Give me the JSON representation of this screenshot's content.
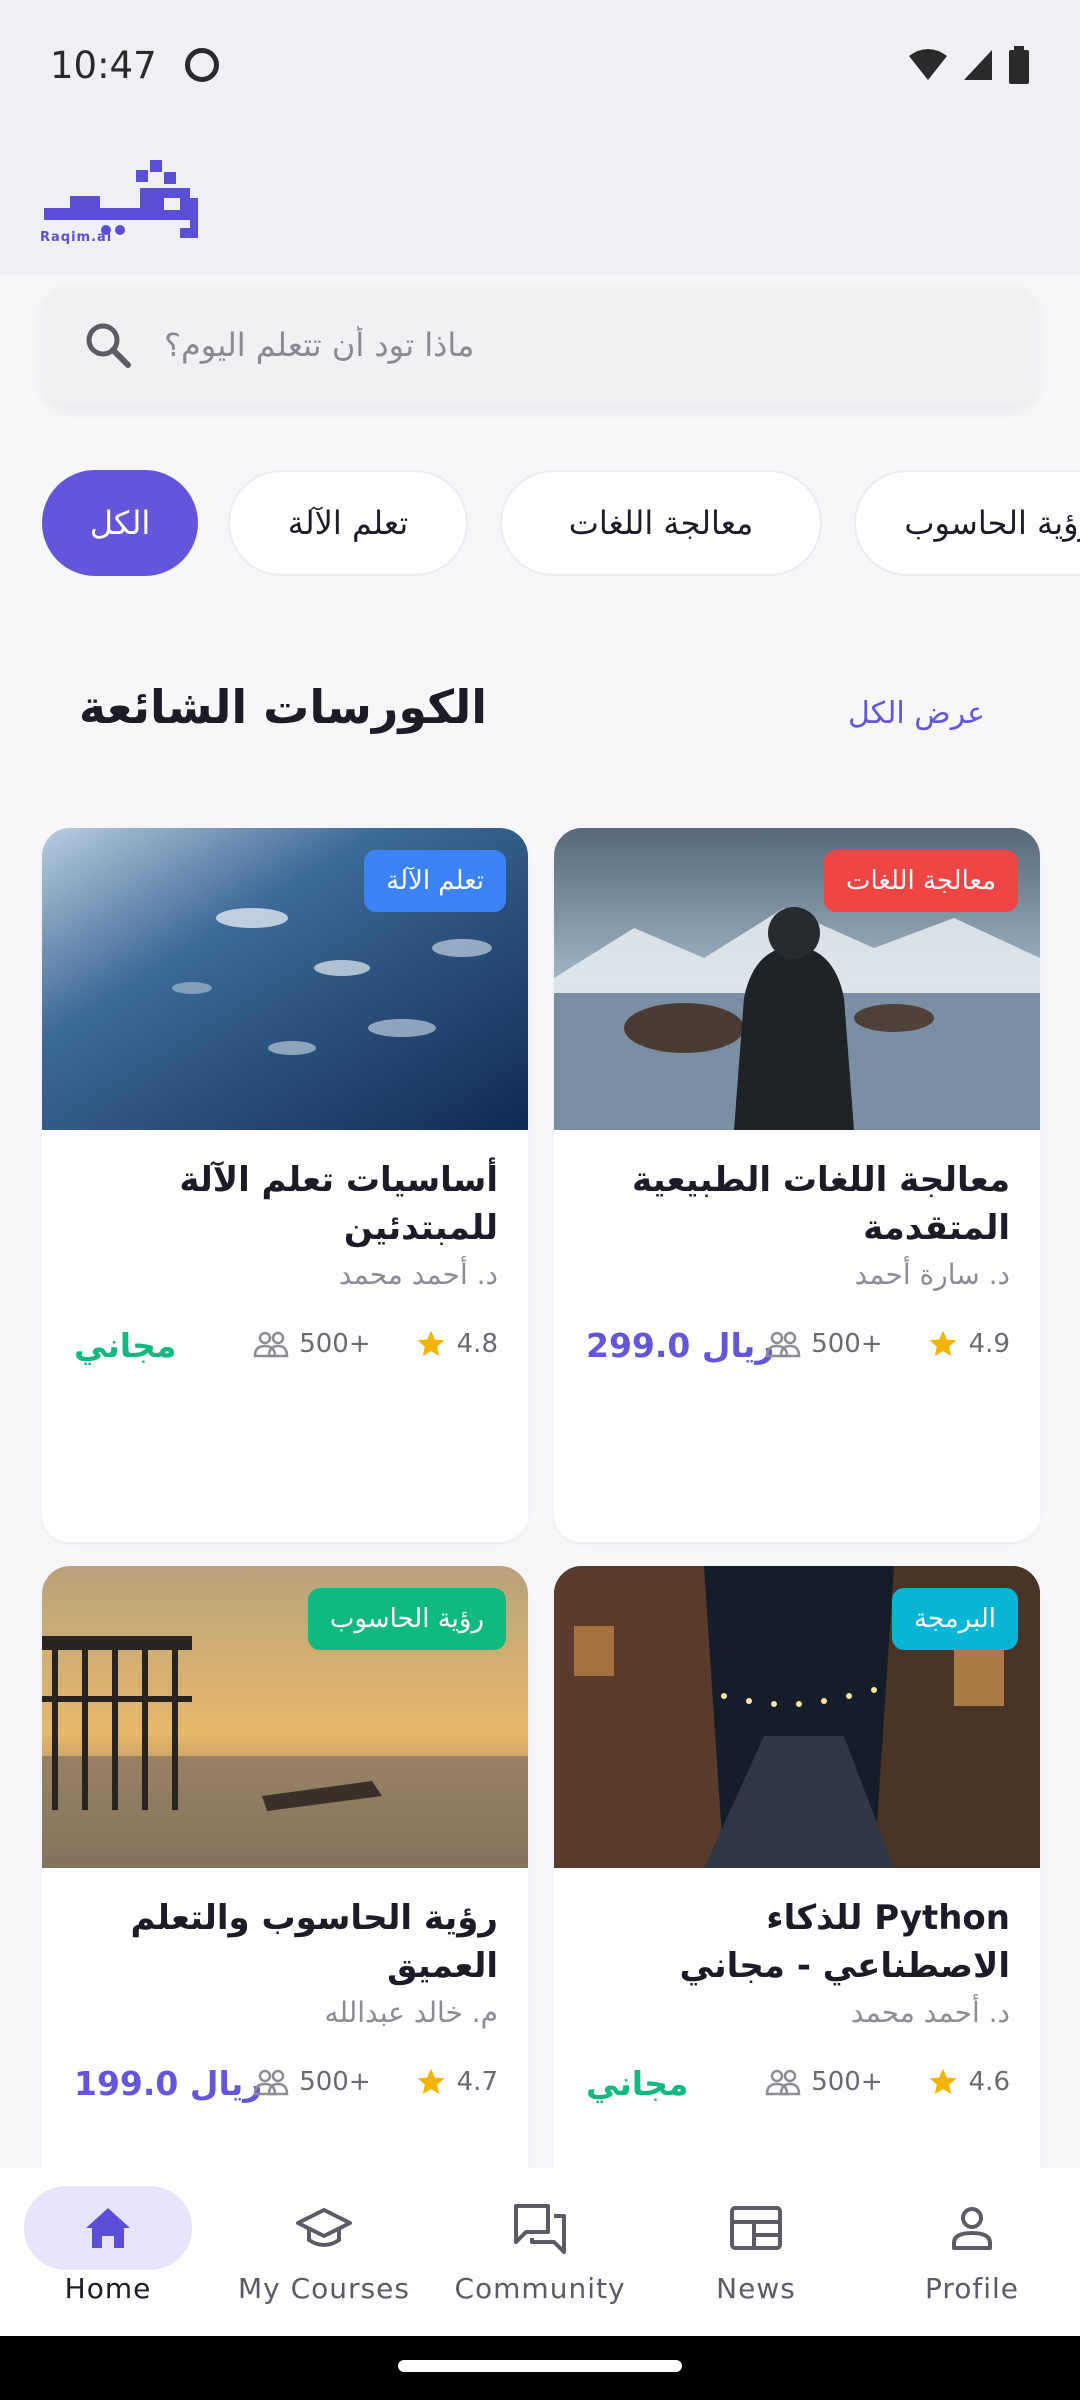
{
  "status": {
    "time": "10:47"
  },
  "header": {
    "logo_text": "Raqim.ai"
  },
  "search": {
    "placeholder": "ماذا تود أن تتعلم اليوم؟"
  },
  "categories": [
    {
      "label": "الكل",
      "active": true
    },
    {
      "label": "تعلم الآلة",
      "active": false
    },
    {
      "label": "معالجة اللغات",
      "active": false
    },
    {
      "label": "رؤية الحاسوب",
      "active": false
    }
  ],
  "section": {
    "title": "الكورسات الشائعة",
    "view_all": "عرض الكل"
  },
  "courses": [
    {
      "badge": "تعلم الآلة",
      "badge_color": "#3b82f6",
      "title": "أساسيات تعلم الآلة للمبتدئين",
      "instructor": "د. أحمد محمد",
      "rating": "4.8",
      "students": "500+",
      "price": "مجاني",
      "price_color": "#10b981"
    },
    {
      "badge": "معالجة اللغات",
      "badge_color": "#ef4444",
      "title": "معالجة اللغات الطبيعية المتقدمة",
      "instructor": "د. سارة أحمد",
      "rating": "4.9",
      "students": "500+",
      "price": "299.0 ريال",
      "price_color": "#6456db"
    },
    {
      "badge": "رؤية الحاسوب",
      "badge_color": "#10b981",
      "title": "رؤية الحاسوب والتعلم العميق",
      "instructor": "م. خالد عبدالله",
      "rating": "4.7",
      "students": "500+",
      "price": "199.0 ريال",
      "price_color": "#6456db"
    },
    {
      "badge": "البرمجة",
      "badge_color": "#06b6d4",
      "title": "Python للذكاء الاصطناعي - مجاني",
      "instructor": "د. أحمد محمد",
      "rating": "4.6",
      "students": "500+",
      "price": "مجاني",
      "price_color": "#10b981"
    }
  ],
  "nav": [
    {
      "label": "Home",
      "icon": "home-icon",
      "active": true
    },
    {
      "label": "My Courses",
      "icon": "graduation-cap-icon",
      "active": false
    },
    {
      "label": "Community",
      "icon": "chat-bubbles-icon",
      "active": false
    },
    {
      "label": "News",
      "icon": "newspaper-icon",
      "active": false
    },
    {
      "label": "Profile",
      "icon": "person-icon",
      "active": false
    }
  ],
  "colors": {
    "primary": "#6456db",
    "free": "#10b981",
    "background": "#f7f7fa",
    "star": "#f5b301"
  }
}
